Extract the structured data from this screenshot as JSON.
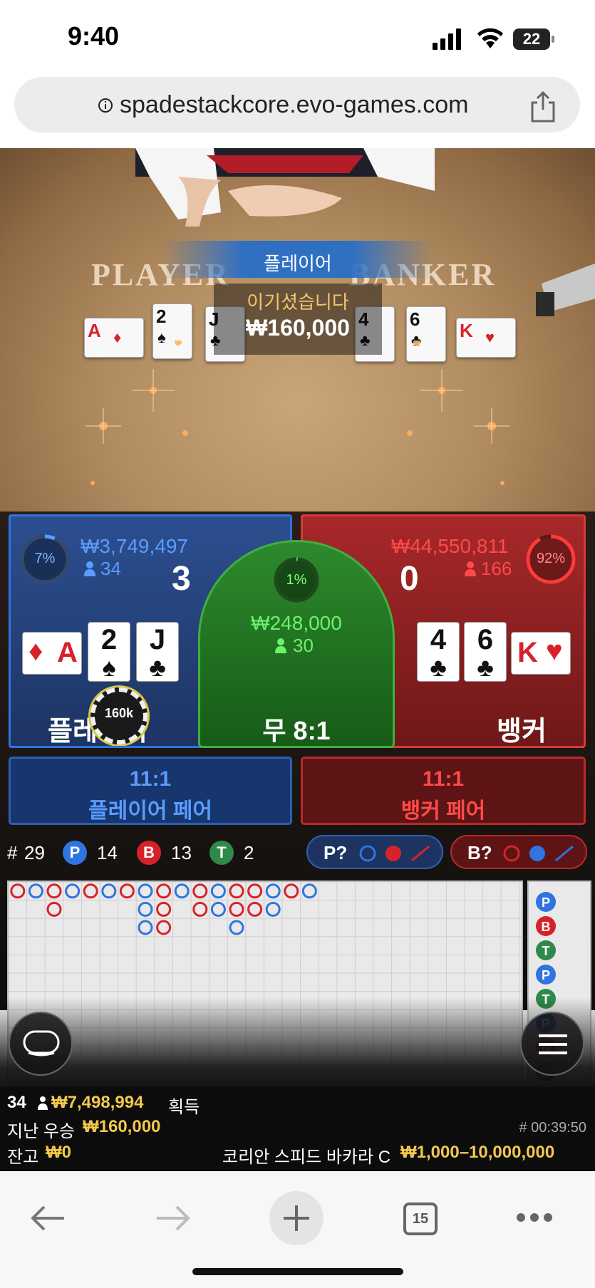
{
  "status_bar": {
    "time": "9:40",
    "battery": "22"
  },
  "browser": {
    "url": "spadestackcore.evo-games.com",
    "tabs_count": "15"
  },
  "video": {
    "felt_player": "PLAYER",
    "felt_banker": "BANKER",
    "banner": "플레이어",
    "win_title": "이기셨습니다",
    "win_amount": "₩160,000",
    "player_cards": [
      {
        "rank": "A",
        "suit": "♦",
        "color": "red"
      },
      {
        "rank": "2",
        "suit": "♠",
        "color": "black"
      },
      {
        "rank": "J",
        "suit": "♣",
        "color": "black"
      }
    ],
    "banker_cards": [
      {
        "rank": "4",
        "suit": "♣",
        "color": "black"
      },
      {
        "rank": "6",
        "suit": "♣",
        "color": "black"
      },
      {
        "rank": "K",
        "suit": "♥",
        "color": "red"
      }
    ]
  },
  "board": {
    "player": {
      "percent": "7%",
      "percent_value": 0.07,
      "amount": "₩3,749,497",
      "bettors": "34",
      "score": "3",
      "label": "플레이어",
      "chip": "160k",
      "cards": [
        {
          "rank": "A",
          "suit": "♦",
          "color": "red",
          "horizontal": true
        },
        {
          "rank": "2",
          "suit": "♠",
          "color": "black"
        },
        {
          "rank": "J",
          "suit": "♣",
          "color": "black"
        }
      ]
    },
    "tie": {
      "percent": "1%",
      "percent_value": 0.01,
      "amount": "₩248,000",
      "bettors": "30",
      "label": "무 8:1"
    },
    "banker": {
      "percent": "92%",
      "percent_value": 0.92,
      "amount": "₩44,550,811",
      "bettors": "166",
      "score": "0",
      "label": "뱅커",
      "cards": [
        {
          "rank": "4",
          "suit": "♣",
          "color": "black"
        },
        {
          "rank": "6",
          "suit": "♣",
          "color": "black"
        },
        {
          "rank": "K",
          "suit": "♥",
          "color": "red",
          "horizontal": true
        }
      ]
    },
    "player_pair": {
      "odds": "11:1",
      "label": "플레이어 페어"
    },
    "banker_pair": {
      "odds": "11:1",
      "label": "뱅커 페어"
    }
  },
  "stats": {
    "rounds_prefix": "#",
    "rounds": "29",
    "player_letter": "P",
    "player_count": "14",
    "banker_letter": "B",
    "banker_count": "13",
    "tie_letter": "T",
    "tie_count": "2",
    "player_predict": "P?",
    "banker_predict": "B?"
  },
  "road": {
    "bead_colors": {
      "P": "#2f74e0",
      "B": "#d8222a",
      "T": "#2f8a4a"
    },
    "big_road": [
      [
        "B"
      ],
      [
        "P"
      ],
      [
        "B",
        "B"
      ],
      [
        "P"
      ],
      [
        "B"
      ],
      [
        "P"
      ],
      [
        "B"
      ],
      [
        "P",
        "P",
        "P"
      ],
      [
        "B",
        "B",
        "B"
      ],
      [
        "P"
      ],
      [
        "B",
        "B"
      ],
      [
        "P",
        "P"
      ],
      [
        "B",
        "B",
        "P"
      ],
      [
        "B",
        "B"
      ],
      [
        "P",
        "P"
      ],
      [
        "B"
      ],
      [
        "P"
      ]
    ],
    "side_bead": [
      "P",
      "B",
      "T",
      "P",
      "T",
      "P",
      "B",
      "B"
    ]
  },
  "footer": {
    "bettors": "34",
    "total_won": "₩7,498,994",
    "won_label": "획득",
    "last_win_label": "지난 우승",
    "last_win": "₩160,000",
    "balance_label": "잔고",
    "balance": "₩0",
    "game_id": "# 00:39:50",
    "table_name": "코리안 스피드 바카라 C",
    "limits": "₩1,000–10,000,000"
  }
}
